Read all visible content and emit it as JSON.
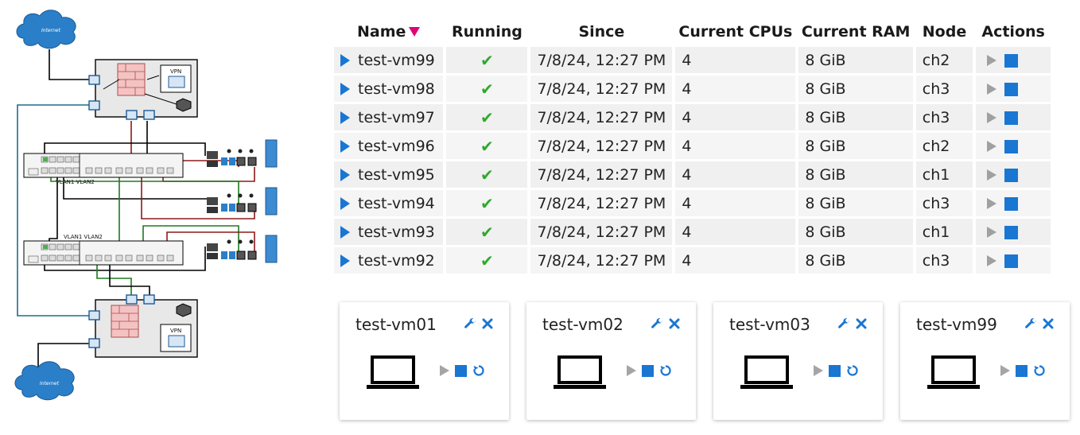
{
  "diagram": {
    "cloud_top": "Internet",
    "cloud_bottom": "Internet",
    "vpn_top": "VPN",
    "vpn_bottom": "VPN",
    "vlan_top": "VLAN1 VLAN2",
    "vlan_bottom": "VLAN1 VLAN2"
  },
  "table": {
    "headers": {
      "name": "Name",
      "running": "Running",
      "since": "Since",
      "cpus": "Current CPUs",
      "ram": "Current RAM",
      "node": "Node",
      "actions": "Actions"
    },
    "rows": [
      {
        "name": "test-vm99",
        "running": "✔",
        "since": "7/8/24, 12:27 PM",
        "cpus": "4",
        "ram": "8 GiB",
        "node": "ch2"
      },
      {
        "name": "test-vm98",
        "running": "✔",
        "since": "7/8/24, 12:27 PM",
        "cpus": "4",
        "ram": "8 GiB",
        "node": "ch3"
      },
      {
        "name": "test-vm97",
        "running": "✔",
        "since": "7/8/24, 12:27 PM",
        "cpus": "4",
        "ram": "8 GiB",
        "node": "ch3"
      },
      {
        "name": "test-vm96",
        "running": "✔",
        "since": "7/8/24, 12:27 PM",
        "cpus": "4",
        "ram": "8 GiB",
        "node": "ch2"
      },
      {
        "name": "test-vm95",
        "running": "✔",
        "since": "7/8/24, 12:27 PM",
        "cpus": "4",
        "ram": "8 GiB",
        "node": "ch1"
      },
      {
        "name": "test-vm94",
        "running": "✔",
        "since": "7/8/24, 12:27 PM",
        "cpus": "4",
        "ram": "8 GiB",
        "node": "ch3"
      },
      {
        "name": "test-vm93",
        "running": "✔",
        "since": "7/8/24, 12:27 PM",
        "cpus": "4",
        "ram": "8 GiB",
        "node": "ch1"
      },
      {
        "name": "test-vm92",
        "running": "✔",
        "since": "7/8/24, 12:27 PM",
        "cpus": "4",
        "ram": "8 GiB",
        "node": "ch3"
      }
    ]
  },
  "cards": [
    {
      "name": "test-vm01"
    },
    {
      "name": "test-vm02"
    },
    {
      "name": "test-vm03"
    },
    {
      "name": "test-vm99"
    }
  ],
  "colors": {
    "accent": "#1976d2",
    "running": "#2eaa2e",
    "sort_arrow": "#e0007a",
    "link_red": "#8b1a1a",
    "link_green": "#1e7a1e",
    "link_teal": "#1e6e8a"
  },
  "icons": {
    "expand": "expand-triangle-icon",
    "running": "check-icon",
    "start": "play-icon",
    "stop": "stop-icon",
    "settings": "wrench-icon",
    "delete": "close-icon",
    "restart": "restart-icon",
    "console": "laptop-icon"
  }
}
